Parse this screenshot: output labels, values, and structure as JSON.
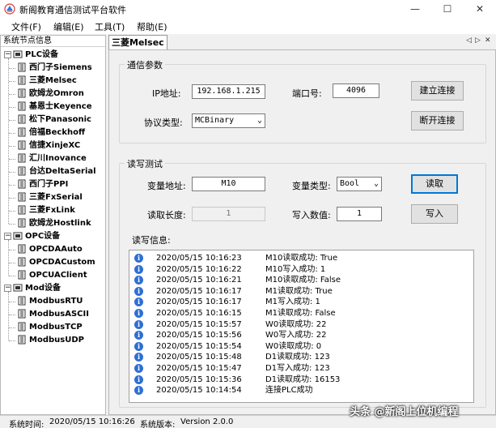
{
  "window": {
    "title": "新阁教育通信测试平台软件",
    "minimize": "—",
    "maximize": "☐",
    "close": "✕"
  },
  "menu": [
    {
      "label": "文件(F)"
    },
    {
      "label": "编辑(E)"
    },
    {
      "label": "工具(T)"
    },
    {
      "label": "帮助(E)"
    }
  ],
  "sidebar": {
    "title": "系统节点信息",
    "groups": [
      {
        "label": "PLC设备",
        "items": [
          "西门子Siemens",
          "三菱Melsec",
          "欧姆龙Omron",
          "基恩士Keyence",
          "松下Panasonic",
          "倍福Beckhoff",
          "信捷XinjeXC",
          "汇川Inovance",
          "台达DeltaSerial",
          "西门子PPI",
          "三菱FxSerial",
          "三菱FxLink",
          "欧姆龙Hostlink"
        ]
      },
      {
        "label": "OPC设备",
        "items": [
          "OPCDAAuto",
          "OPCDACustom",
          "OPCUAClient"
        ]
      },
      {
        "label": "Mod设备",
        "items": [
          "ModbusRTU",
          "ModbusASCII",
          "ModbusTCP",
          "ModbusUDP"
        ]
      }
    ]
  },
  "tabs": {
    "active": "三菱Melsec",
    "nav_prev": "◁",
    "nav_next": "▷",
    "nav_close": "✕"
  },
  "comm": {
    "group_title": "通信参数",
    "ip_label": "IP地址:",
    "ip_value": "192.168.1.215",
    "port_label": "端口号:",
    "port_value": "4096",
    "protocol_label": "协议类型:",
    "protocol_value": "MCBinary",
    "connect_btn": "建立连接",
    "disconnect_btn": "断开连接"
  },
  "rw": {
    "group_title": "读写测试",
    "var_addr_label": "变量地址:",
    "var_addr_value": "M10",
    "var_type_label": "变量类型:",
    "var_type_value": "Bool",
    "read_btn": "读取",
    "read_len_label": "读取长度:",
    "read_len_value": "1",
    "write_val_label": "写入数值:",
    "write_val_value": "1",
    "write_btn": "写入",
    "log_label": "读写信息:"
  },
  "log": [
    {
      "time": "2020/05/15 10:16:23",
      "msg": "M10读取成功: True"
    },
    {
      "time": "2020/05/15 10:16:22",
      "msg": "M10写入成功: 1"
    },
    {
      "time": "2020/05/15 10:16:21",
      "msg": "M10读取成功: False"
    },
    {
      "time": "2020/05/15 10:16:17",
      "msg": "M1读取成功: True"
    },
    {
      "time": "2020/05/15 10:16:17",
      "msg": "M1写入成功: 1"
    },
    {
      "time": "2020/05/15 10:16:15",
      "msg": "M1读取成功: False"
    },
    {
      "time": "2020/05/15 10:15:57",
      "msg": "W0读取成功: 22"
    },
    {
      "time": "2020/05/15 10:15:56",
      "msg": "W0写入成功: 22"
    },
    {
      "time": "2020/05/15 10:15:54",
      "msg": "W0读取成功: 0"
    },
    {
      "time": "2020/05/15 10:15:48",
      "msg": "D1读取成功: 123"
    },
    {
      "time": "2020/05/15 10:15:47",
      "msg": "D1写入成功: 123"
    },
    {
      "time": "2020/05/15 10:15:36",
      "msg": "D1读取成功: 16153"
    },
    {
      "time": "2020/05/15 10:14:54",
      "msg": "连接PLC成功"
    }
  ],
  "status": {
    "time_label": "系统时间:",
    "time_value": "2020/05/15 10:16:26",
    "version_label": "系统版本:",
    "version_value": "Version 2.0.0"
  },
  "watermark": "头条 @新阁上位机编程",
  "colors": {
    "info_icon": "#2e6fd2",
    "focus_border": "#0078d7"
  }
}
